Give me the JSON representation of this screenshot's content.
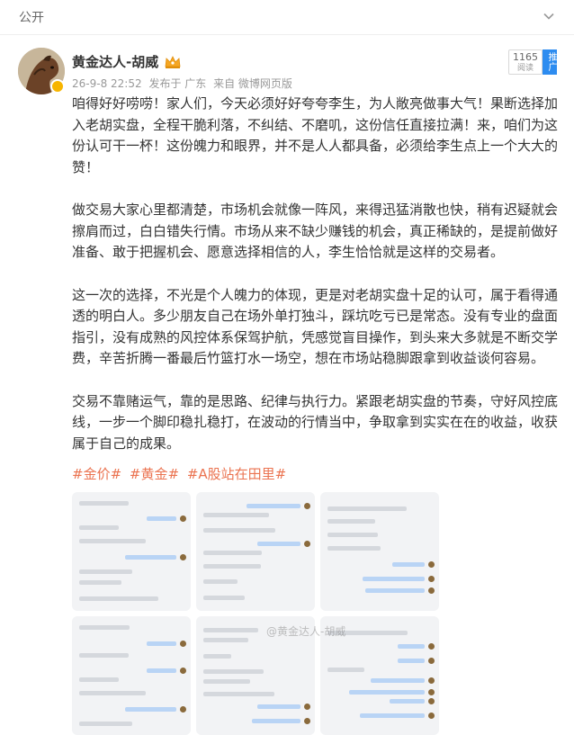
{
  "header": {
    "visibility": "公开"
  },
  "post": {
    "username": "黄金达人-胡威",
    "date": "26-9-8 22:52",
    "location": "发布于 广东",
    "source": "来自 微博网页版",
    "read_count": "1165",
    "read_label": "阅读",
    "promo_label": "推广",
    "paragraphs": [
      "咱得好好唠唠！家人们，今天必须好好夸夸李生，为人敞亮做事大气！果断选择加入老胡实盘，全程干脆利落，不纠结、不磨叽，这份信任直接拉满！来，咱们为这份认可干一杯！这份魄力和眼界，并不是人人都具备，必须给李生点上一个大大的赞！",
      "做交易大家心里都清楚，市场机会就像一阵风，来得迅猛消散也快，稍有迟疑就会擦肩而过，白白错失行情。市场从来不缺少赚钱的机会，真正稀缺的，是提前做好准备、敢于把握机会、愿意选择相信的人，李生恰恰就是这样的交易者。",
      "这一次的选择，不光是个人魄力的体现，更是对老胡实盘十足的认可，属于看得通透的明白人。多少朋友自己在场外单打独斗，踩坑吃亏已是常态。没有专业的盘面指引，没有成熟的风控体系保驾护航，凭感觉盲目操作，到头来大多就是不断交学费，辛苦折腾一番最后竹篮打水一场空，想在市场站稳脚跟拿到收益谈何容易。",
      "交易不靠赌运气，靠的是思路、纪律与执行力。紧跟老胡实盘的节奏，守好风控底线，一步一个脚印稳扎稳打，在波动的行情当中，争取拿到实实在在的收益，收获属于自己的成果。"
    ],
    "hashtags": [
      "#金价#",
      "#黄金#",
      "#A股站在田里#"
    ]
  },
  "watermark": "@黄金达人-胡威",
  "icons": {
    "visibility_toggle": "chevron-down-icon",
    "crown": "crown-icon",
    "verified": "verified-badge-icon"
  },
  "colors": {
    "hashtag": "#eb7350",
    "promo": "#2d8cf0",
    "badge": "#f7b500"
  }
}
